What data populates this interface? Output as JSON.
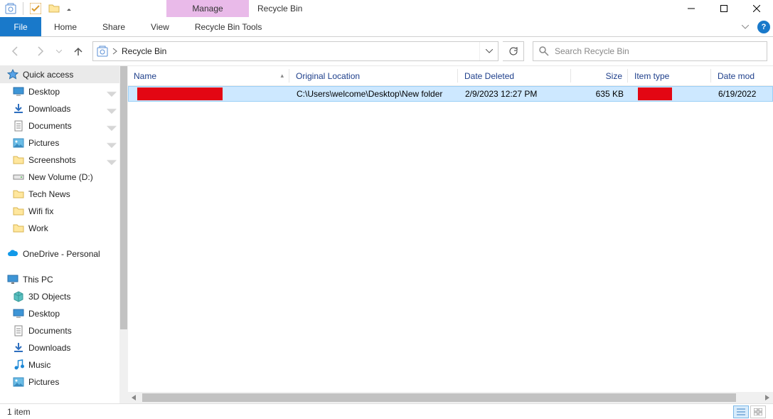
{
  "window": {
    "title": "Recycle Bin",
    "contextTab": "Manage"
  },
  "ribbon": {
    "file": "File",
    "tabs": [
      "Home",
      "Share",
      "View"
    ],
    "tools": "Recycle Bin Tools"
  },
  "address": {
    "location": "Recycle Bin"
  },
  "search": {
    "placeholder": "Search Recycle Bin"
  },
  "sidebar": {
    "quickAccess": "Quick access",
    "qa": [
      {
        "label": "Desktop",
        "icon": "desktop",
        "pinned": true
      },
      {
        "label": "Downloads",
        "icon": "download",
        "pinned": true
      },
      {
        "label": "Documents",
        "icon": "document",
        "pinned": true
      },
      {
        "label": "Pictures",
        "icon": "pictures",
        "pinned": true
      },
      {
        "label": "Screenshots",
        "icon": "folder",
        "pinned": true
      },
      {
        "label": "New Volume (D:)",
        "icon": "drive",
        "pinned": false
      },
      {
        "label": "Tech News",
        "icon": "folder",
        "pinned": false
      },
      {
        "label": "Wifi fix",
        "icon": "folder",
        "pinned": false
      },
      {
        "label": "Work",
        "icon": "folder",
        "pinned": false
      }
    ],
    "onedrive": "OneDrive - Personal",
    "thispc": "This PC",
    "pc": [
      {
        "label": "3D Objects",
        "icon": "3d"
      },
      {
        "label": "Desktop",
        "icon": "desktop"
      },
      {
        "label": "Documents",
        "icon": "document"
      },
      {
        "label": "Downloads",
        "icon": "download"
      },
      {
        "label": "Music",
        "icon": "music"
      },
      {
        "label": "Pictures",
        "icon": "pictures"
      }
    ]
  },
  "columns": {
    "name": "Name",
    "location": "Original Location",
    "deleted": "Date Deleted",
    "size": "Size",
    "type": "Item type",
    "modified": "Date mod"
  },
  "rows": [
    {
      "name": "",
      "location": "C:\\Users\\welcome\\Desktop\\New folder",
      "deleted": "2/9/2023 12:27 PM",
      "size": "635 KB",
      "type": "",
      "modified": "6/19/2022"
    }
  ],
  "status": {
    "count": "1 item"
  }
}
